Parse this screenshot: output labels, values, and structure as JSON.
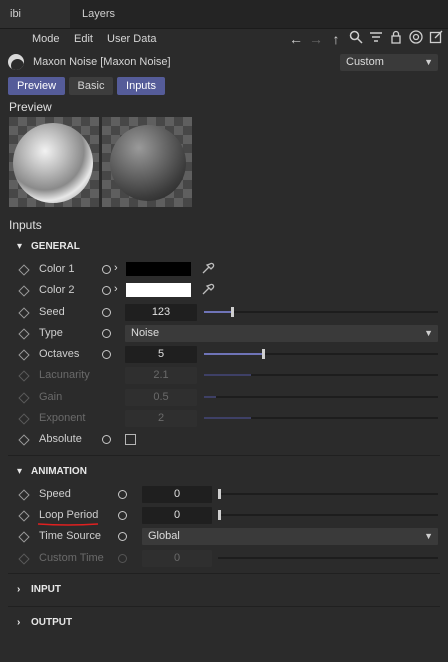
{
  "tabs": {
    "tab1": "ibi",
    "tab2": "Layers"
  },
  "menu": {
    "mode": "Mode",
    "edit": "Edit",
    "user_data": "User Data"
  },
  "object": {
    "title": "Maxon Noise [Maxon Noise]",
    "mode_value": "Custom"
  },
  "tab_buttons": {
    "preview": "Preview",
    "basic": "Basic",
    "inputs": "Inputs"
  },
  "sections": {
    "preview": "Preview",
    "inputs": "Inputs"
  },
  "groups": {
    "general": "GENERAL",
    "animation": "ANIMATION",
    "input": "INPUT",
    "output": "OUTPUT"
  },
  "params": {
    "color1": {
      "label": "Color 1",
      "color": "#000000"
    },
    "color2": {
      "label": "Color 2",
      "color": "#ffffff"
    },
    "seed": {
      "label": "Seed",
      "value": "123",
      "slider": 0.12
    },
    "type": {
      "label": "Type",
      "value": "Noise"
    },
    "octaves": {
      "label": "Octaves",
      "value": "5",
      "slider": 0.25
    },
    "lacunarity": {
      "label": "Lacunarity",
      "value": "2.1",
      "slider": 0.2
    },
    "gain": {
      "label": "Gain",
      "value": "0.5",
      "slider": 0.05
    },
    "exponent": {
      "label": "Exponent",
      "value": "2",
      "slider": 0.2
    },
    "absolute": {
      "label": "Absolute",
      "checked": false
    },
    "speed": {
      "label": "Speed",
      "value": "0",
      "slider": 0.0
    },
    "loop_period": {
      "label": "Loop Period",
      "value": "0",
      "slider": 0.0
    },
    "time_source": {
      "label": "Time Source",
      "value": "Global"
    },
    "custom_time": {
      "label": "Custom Time",
      "value": "0"
    }
  },
  "colors": {
    "accent": "#555c99",
    "annotation": "#e02020"
  }
}
